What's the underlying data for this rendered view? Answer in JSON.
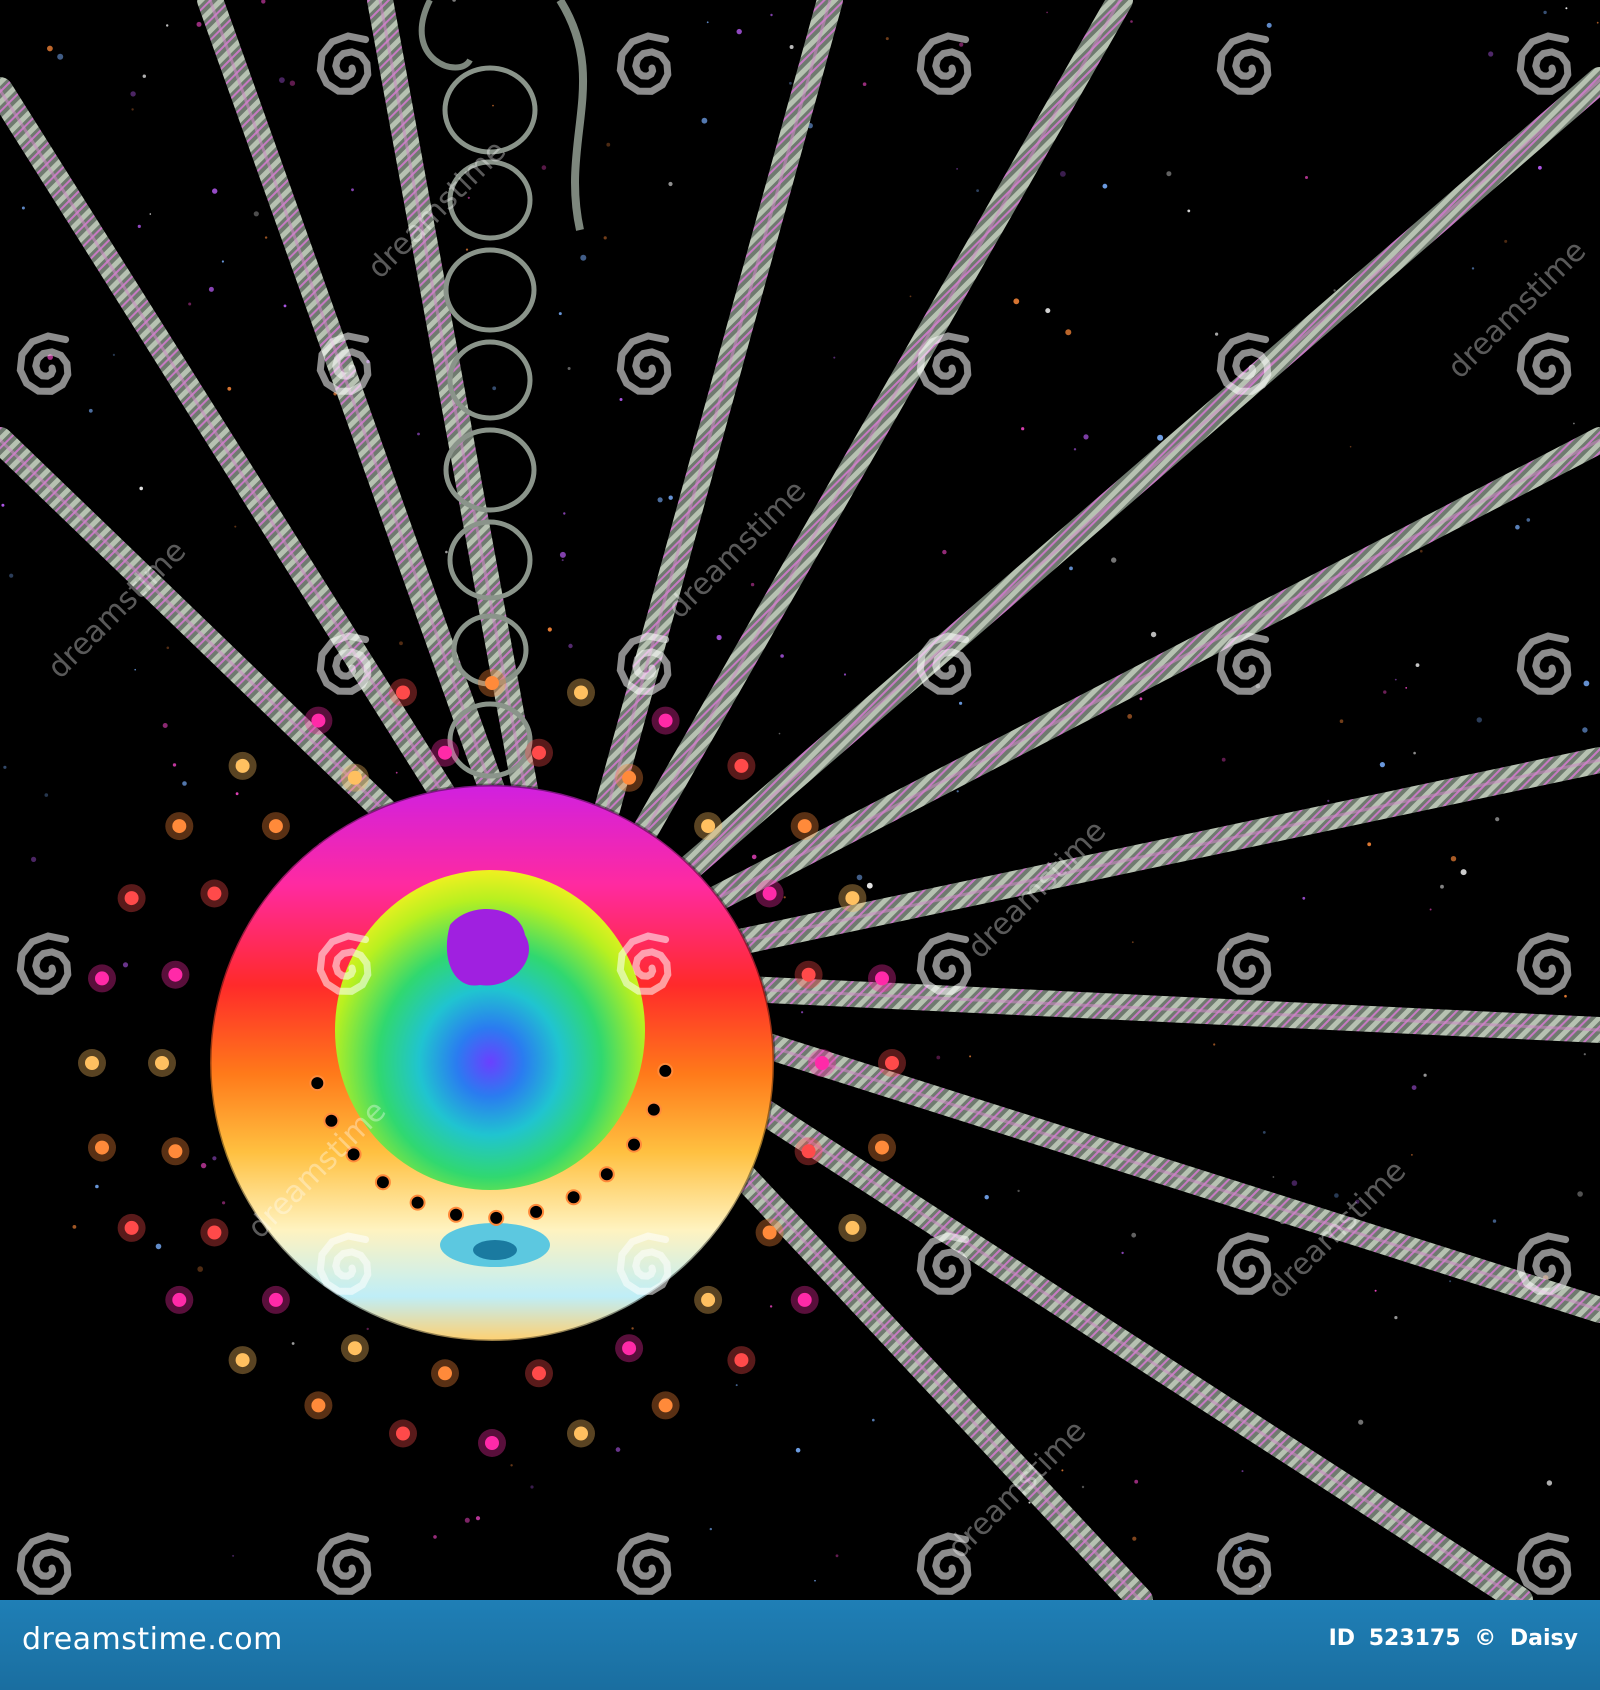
{
  "image": {
    "subject": "fractal",
    "palette": {
      "background": "#000000",
      "ring_colors": [
        "#ff2aa8",
        "#ff2a2a",
        "#ff7a1a",
        "#ffc040",
        "#fff3c0",
        "#c8f0f8",
        "#5cc8e0"
      ],
      "inner_colors": [
        "#c8f000",
        "#40e040",
        "#20d0c0",
        "#2090e8",
        "#6a40ff",
        "#c020e0"
      ],
      "beam_color": "#9aa39a",
      "beam_highlight": "#d08ac8"
    }
  },
  "watermark": {
    "text": "dreamstime",
    "icon": "spiral-logo-icon"
  },
  "footer": {
    "site": "dreamstime.com",
    "id_label": "ID",
    "id_value": "523175",
    "copyright_symbol": "©",
    "author": "Daisy",
    "background": "#1f7fb6"
  }
}
